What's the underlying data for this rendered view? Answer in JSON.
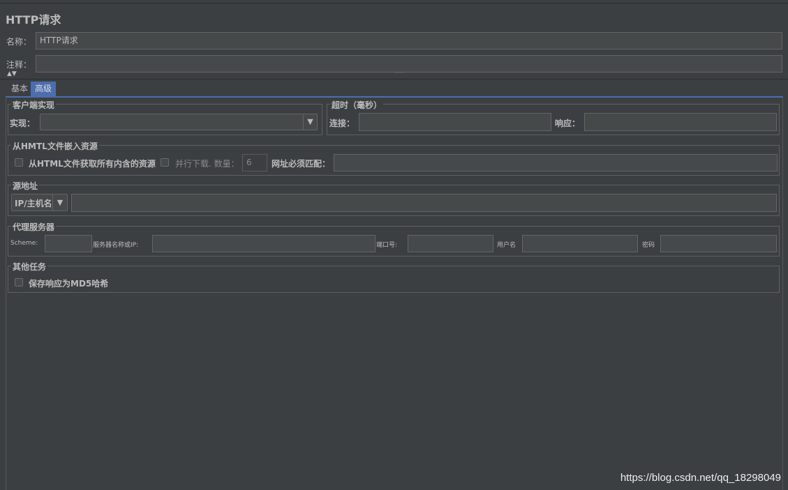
{
  "header": {
    "title": "HTTP请求",
    "name_label": "名称：",
    "name_value": "HTTP请求",
    "comment_label": "注释：",
    "comment_value": ""
  },
  "tabs": [
    {
      "label": "基本",
      "active": false
    },
    {
      "label": "高级",
      "active": true
    }
  ],
  "client_impl": {
    "group_label": "客户端实现",
    "impl_label": "实现：",
    "impl_value": ""
  },
  "timeout": {
    "group_label": "超时（毫秒）",
    "connect_label": "连接：",
    "connect_value": "",
    "response_label": "响应：",
    "response_value": ""
  },
  "embedded": {
    "group_label": "从HMTL文件嵌入资源",
    "retrieve_all_label": "从HTML文件获取所有内含的资源",
    "parallel_label": "并行下载. 数量：",
    "parallel_count": "6",
    "url_match_label": "网址必须匹配：",
    "url_match_value": ""
  },
  "source": {
    "group_label": "源地址",
    "type_value": "IP/主机名",
    "address_value": ""
  },
  "proxy": {
    "group_label": "代理服务器",
    "scheme_label": "Scheme:",
    "scheme_value": "",
    "host_label": "服务器名称或IP:",
    "host_value": "",
    "port_label": "端口号:",
    "port_value": "",
    "user_label": "用户名",
    "user_value": "",
    "password_label": "密码",
    "password_value": ""
  },
  "other": {
    "group_label": "其他任务",
    "md5_label": "保存响应为MD5哈希"
  },
  "icons": {
    "dropdown": "▼",
    "collapse": "▲▼",
    "grip": "˙˙˙˙˙"
  },
  "watermark": "https://blog.csdn.net/qq_18298049"
}
